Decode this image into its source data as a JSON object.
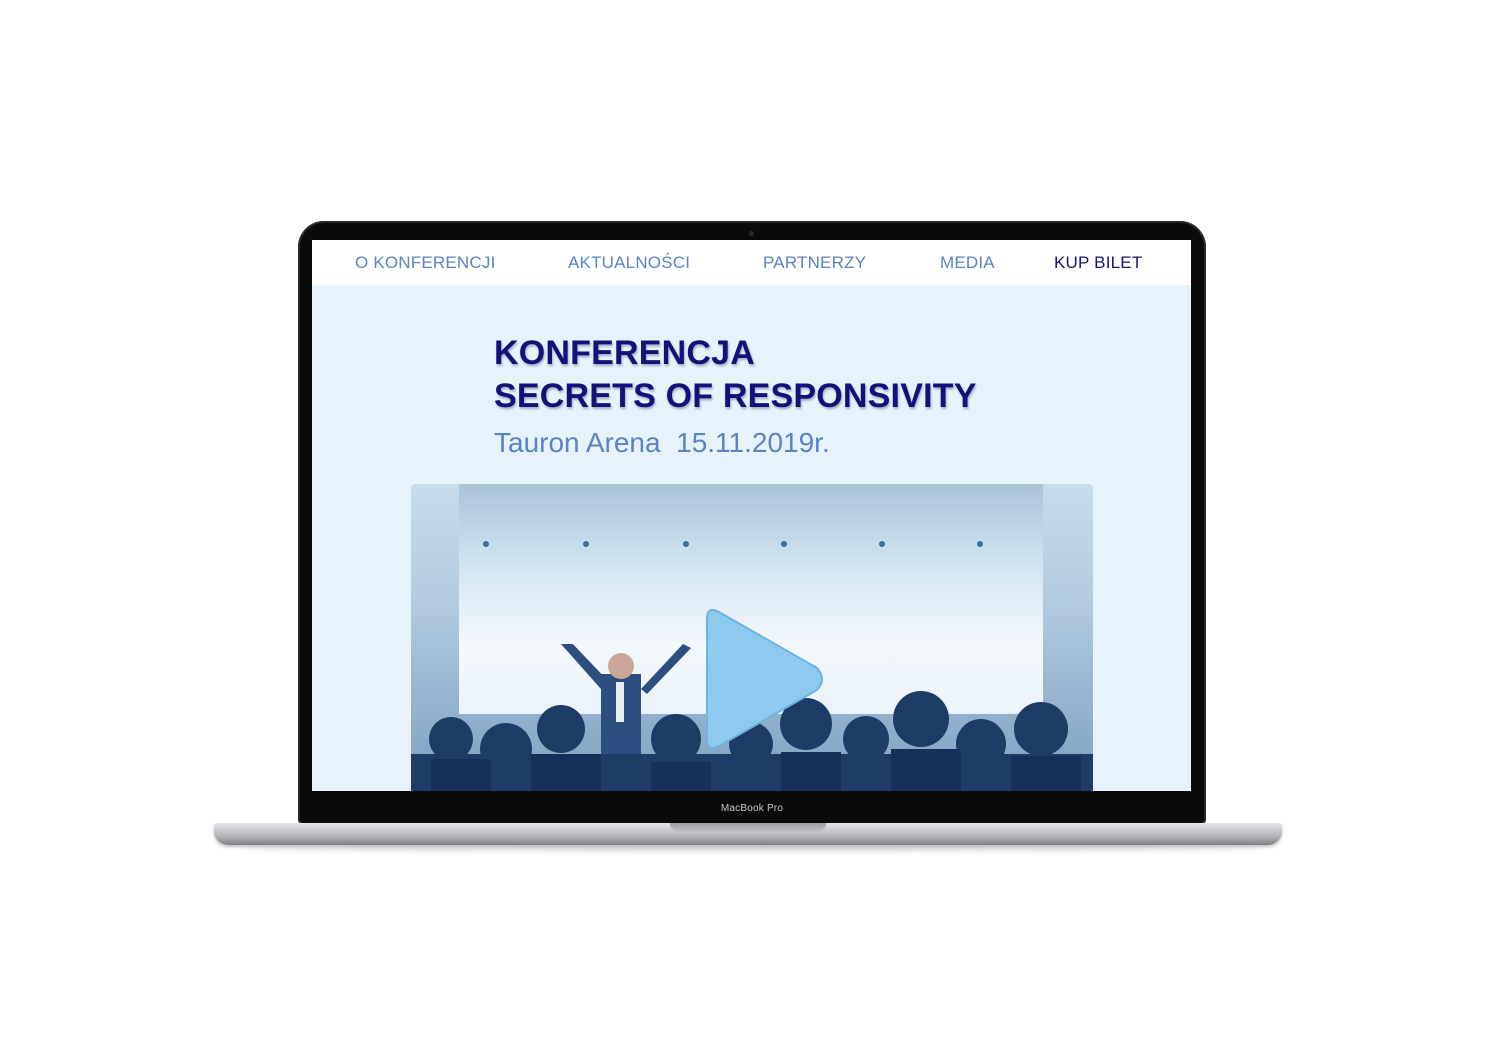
{
  "device": {
    "label": "MacBook Pro"
  },
  "site": {
    "nav": {
      "items": [
        {
          "label": "O KONFERENCJI"
        },
        {
          "label": "AKTUALNOŚCI"
        },
        {
          "label": "PARTNERZY"
        },
        {
          "label": "MEDIA"
        },
        {
          "label": "KUP BILET"
        }
      ],
      "active_item": "KUP BILET"
    },
    "hero": {
      "title_line1": "KONFERENCJA",
      "title_line2": "SECRETS OF RESPONSIVITY",
      "subtitle": "Tauron Arena  15.11.2019r."
    },
    "video": {
      "play_icon": "play-icon",
      "thumbnail_description_icon": "conference-crowd-image"
    }
  },
  "colors": {
    "nav_text": "#5a82c4",
    "nav_active": "#15157a",
    "title": "#12127a",
    "subtitle": "#5a82c4",
    "screen_background": "#e6f3fb",
    "play_button": "#8ec9ef"
  }
}
